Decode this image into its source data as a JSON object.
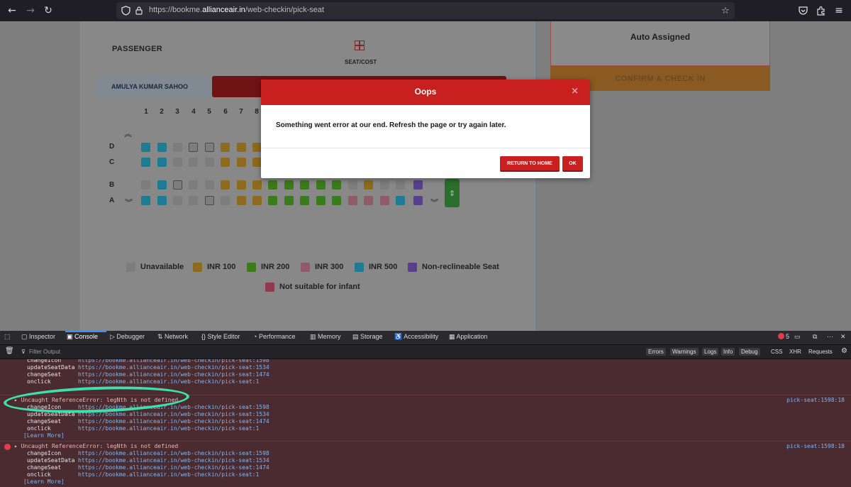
{
  "browser": {
    "url_prefix": "https://bookme.",
    "url_domain": "allianceair.in",
    "url_suffix": "/web-checkin/pick-seat"
  },
  "page": {
    "passenger_heading": "PASSENGER",
    "seat_cost_label": "SEAT/COST",
    "passenger_name": "AMULYA KUMAR SAHOO",
    "auto_assigned": "Auto Assigned",
    "confirm_button": "CONFIRM & CHECK IN",
    "columns": [
      "1",
      "2",
      "3",
      "4",
      "5",
      "6",
      "7",
      "8"
    ],
    "rows": [
      "D",
      "C",
      "B",
      "A"
    ],
    "legend": [
      {
        "label": "Unavailable",
        "color": "#7d7d7d"
      },
      {
        "label": "INR 100",
        "color": "#8c6a1e"
      },
      {
        "label": "INR 200",
        "color": "#3c7a1e"
      },
      {
        "label": "INR 300",
        "color": "#8f5a6a"
      },
      {
        "label": "INR 500",
        "color": "#1e7c92"
      },
      {
        "label": "Non-reclineable Seat",
        "color": "#5a3f8e"
      },
      {
        "label": "Not suitable for infant",
        "color": "#8f3a4e"
      }
    ]
  },
  "modal": {
    "title": "Oops",
    "close": "×",
    "message": "Something went error at our end. Refresh the page or try again later.",
    "return_button": "RETURN TO HOME",
    "ok_button": "OK"
  },
  "devtools": {
    "tabs": [
      "Inspector",
      "Console",
      "Debugger",
      "Network",
      "Style Editor",
      "Performance",
      "Memory",
      "Storage",
      "Accessibility",
      "Application"
    ],
    "active_tab": "Console",
    "error_count": "5",
    "filter_placeholder": "Filter Output",
    "filter_buttons": [
      "Errors",
      "Warnings",
      "Logs",
      "Info",
      "Debug"
    ],
    "filter_extra": [
      "CSS",
      "XHR",
      "Requests"
    ],
    "error_message": "Uncaught ReferenceError: legNth is not defined",
    "error_location": "pick-seat:1598:18",
    "stack": [
      {
        "fn": "changeIcon",
        "link": "https://bookme.allianceair.in/web-checkin/pick-seat:1598"
      },
      {
        "fn": "updateSeatData",
        "link": "https://bookme.allianceair.in/web-checkin/pick-seat:1534"
      },
      {
        "fn": "changeSeat",
        "link": "https://bookme.allianceair.in/web-checkin/pick-seat:1474"
      },
      {
        "fn": "onclick",
        "link": "https://bookme.allianceair.in/web-checkin/pick-seat:1"
      }
    ],
    "learn_more": "[Learn More]"
  }
}
